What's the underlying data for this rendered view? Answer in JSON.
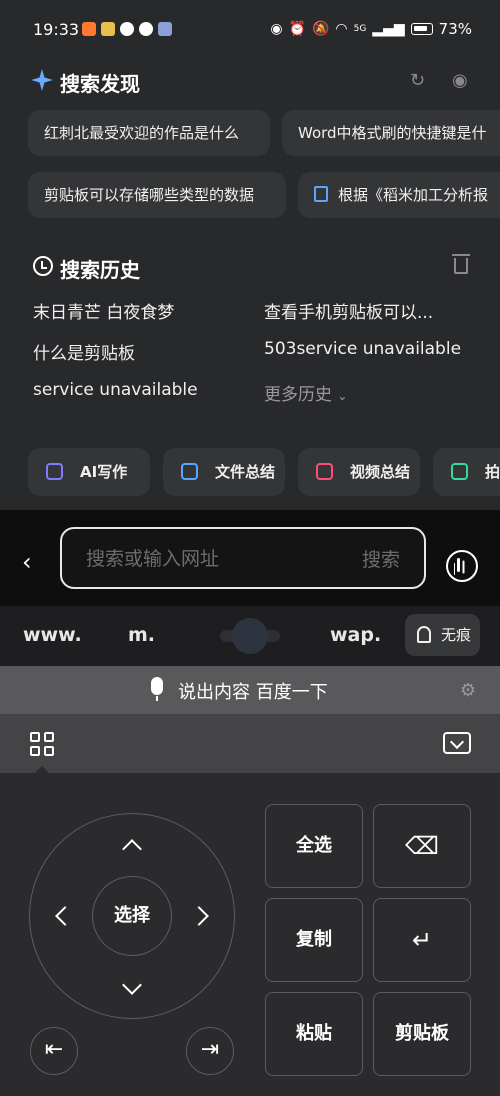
{
  "status": {
    "time": "19:33",
    "network": "5G",
    "battery": "73%"
  },
  "discover": {
    "title": "搜索发现",
    "chips": [
      "红刺北最受欢迎的作品是什么",
      "Word中格式刷的快捷键是什",
      "剪贴板可以存储哪些类型的数据",
      "根据《稻米加工分析报"
    ]
  },
  "history": {
    "title": "搜索历史",
    "items": [
      "末日青芒 白夜食梦",
      "查看手机剪贴板可以...",
      "什么是剪贴板",
      "503service unavailable",
      "service unavailable"
    ],
    "more": "更多历史"
  },
  "tools": [
    "AI写作",
    "文件总结",
    "视频总结",
    "拍题"
  ],
  "search": {
    "placeholder": "搜索或输入网址",
    "go": "搜索"
  },
  "quick_input": {
    "www": "www.",
    "m": "m.",
    "wap": "wap.",
    "incognito": "无痕"
  },
  "voice": {
    "label": "说出内容 百度一下"
  },
  "keypad": {
    "select": "选择",
    "select_all": "全选",
    "copy": "复制",
    "paste": "粘贴",
    "clipboard": "剪贴板"
  },
  "colors": {
    "tool_ai": "#7b7cff",
    "tool_file": "#5aa5ff",
    "tool_video": "#ff4d7a",
    "tool_photo": "#3ad6a0"
  }
}
